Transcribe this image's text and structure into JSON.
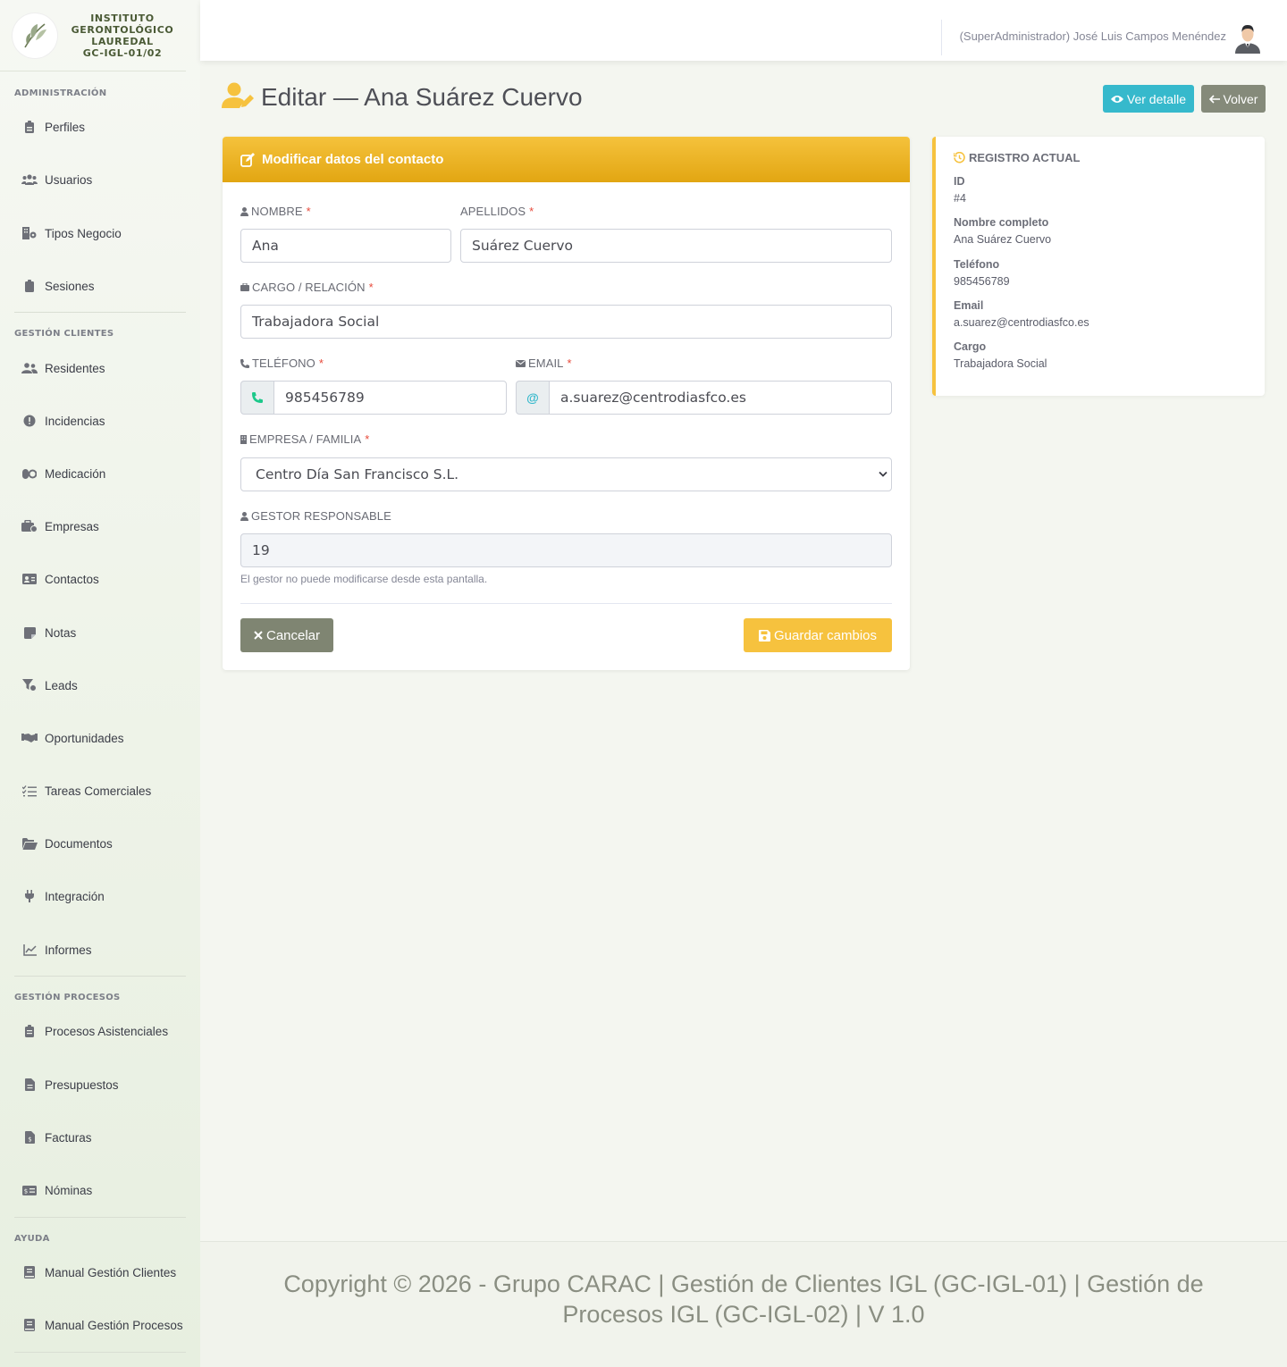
{
  "brand": {
    "line1": "INSTITUTO",
    "line2": "GERONTOLÓGICO",
    "line3": "LAUREDAL",
    "line4": "GC-IGL-01/02"
  },
  "sidebar": {
    "headings": [
      "ADMINISTRACIÓN",
      "GESTIÓN CLIENTES",
      "GESTIÓN PROCESOS",
      "AYUDA"
    ],
    "admin": [
      {
        "label": "Perfiles",
        "icon": "id-badge-icon"
      },
      {
        "label": "Usuarios",
        "icon": "users-icon"
      },
      {
        "label": "Tipos Negocio",
        "icon": "building-icon"
      },
      {
        "label": "Sesiones",
        "icon": "clipboard-icon"
      }
    ],
    "clientes": [
      {
        "label": "Residentes",
        "icon": "user-group-icon"
      },
      {
        "label": "Incidencias",
        "icon": "alert-circle-icon"
      },
      {
        "label": "Medicación",
        "icon": "pills-icon"
      },
      {
        "label": "Empresas",
        "icon": "briefcase-icon"
      },
      {
        "label": "Contactos",
        "icon": "address-card-icon"
      },
      {
        "label": "Notas",
        "icon": "sticky-note-icon"
      },
      {
        "label": "Leads",
        "icon": "funnel-icon"
      },
      {
        "label": "Oportunidades",
        "icon": "handshake-icon"
      },
      {
        "label": "Tareas Comerciales",
        "icon": "task-list-icon"
      },
      {
        "label": "Documentos",
        "icon": "folder-open-icon"
      },
      {
        "label": "Integración",
        "icon": "plug-icon"
      },
      {
        "label": "Informes",
        "icon": "line-chart-icon"
      }
    ],
    "procesos": [
      {
        "label": "Procesos Asistenciales",
        "icon": "clipboard-list-icon"
      },
      {
        "label": "Presupuestos",
        "icon": "file-text-icon"
      },
      {
        "label": "Facturas",
        "icon": "invoice-icon"
      },
      {
        "label": "Nóminas",
        "icon": "money-card-icon"
      }
    ],
    "ayuda": [
      {
        "label": "Manual Gestión Clientes",
        "icon": "book-icon"
      },
      {
        "label": "Manual Gestión Procesos",
        "icon": "book-icon"
      }
    ]
  },
  "topbar": {
    "user": "(SuperAdministrador) José Luis Campos Menéndez"
  },
  "page": {
    "title": "Editar — Ana Suárez Cuervo",
    "btn_view": "Ver detalle",
    "btn_back": "Volver"
  },
  "form": {
    "card_title": "Modificar datos del contacto",
    "nombre_label": "NOMBRE",
    "nombre_value": "Ana",
    "apellidos_label": "APELLIDOS",
    "apellidos_value": "Suárez Cuervo",
    "cargo_label": "CARGO / RELACIÓN",
    "cargo_value": "Trabajadora Social",
    "telefono_label": "TELÉFONO",
    "telefono_value": "985456789",
    "email_label": "EMAIL",
    "email_addon": "@",
    "email_value": "a.suarez@centrodiasfco.es",
    "empresa_label": "EMPRESA / FAMILIA",
    "empresa_value": "Centro Día San Francisco S.L.",
    "gestor_label": "GESTOR RESPONSABLE",
    "gestor_value": "19",
    "gestor_help": "El gestor no puede modificarse desde esta pantalla.",
    "required_mark": "*",
    "cancel": "Cancelar",
    "save": "Guardar cambios"
  },
  "record": {
    "title": "REGISTRO ACTUAL",
    "id_label": "ID",
    "id_value": "#4",
    "name_label": "Nombre completo",
    "name_value": "Ana Suárez Cuervo",
    "phone_label": "Teléfono",
    "phone_value": "985456789",
    "email_label": "Email",
    "email_value": "a.suarez@centrodiasfco.es",
    "cargo_label": "Cargo",
    "cargo_value": "Trabajadora Social"
  },
  "footer": {
    "text": "Copyright © 2026 - Grupo CARAC | Gestión de Clientes IGL (GC-IGL-01) | Gestión de Procesos IGL (GC-IGL-02) | V 1.0"
  },
  "colors": {
    "accent": "#f6c23e",
    "info": "#36b9cc",
    "secondary": "#858a7a",
    "danger": "#e74a3b"
  }
}
